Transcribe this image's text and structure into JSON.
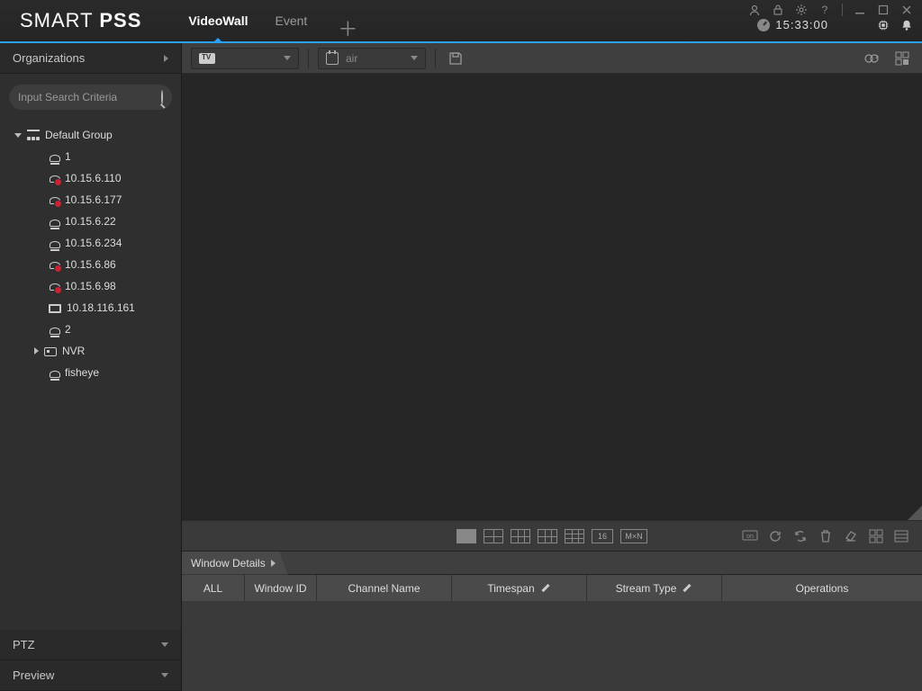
{
  "app": {
    "logo_light": "SMART",
    "logo_bold": "PSS"
  },
  "tabs": {
    "videowall": "VideoWall",
    "event": "Event"
  },
  "header": {
    "time": "15:33:00"
  },
  "sidebar": {
    "org_title": "Organizations",
    "search_placeholder": "Input Search Criteria",
    "ptz": "PTZ",
    "preview": "Preview",
    "tree": {
      "root": "Default Group",
      "items": [
        {
          "label": "1",
          "icon": "cam"
        },
        {
          "label": "10.15.6.110",
          "icon": "camerr"
        },
        {
          "label": "10.15.6.177",
          "icon": "camerr"
        },
        {
          "label": "10.15.6.22",
          "icon": "cam"
        },
        {
          "label": "10.15.6.234",
          "icon": "cam"
        },
        {
          "label": "10.15.6.86",
          "icon": "camerr"
        },
        {
          "label": "10.15.6.98",
          "icon": "camerr"
        },
        {
          "label": "10.18.116.161",
          "icon": "dev"
        },
        {
          "label": "2",
          "icon": "cam"
        },
        {
          "label": "NVR",
          "icon": "nvr",
          "expandable": true
        },
        {
          "label": "fisheye",
          "icon": "cam"
        }
      ]
    }
  },
  "toolbar": {
    "dd2_text": "air"
  },
  "layout": {
    "num16": "16",
    "mxn": "M×N"
  },
  "details": {
    "tab": "Window Details",
    "cols": {
      "all": "ALL",
      "winid": "Window ID",
      "chan": "Channel Name",
      "timespan": "Timespan",
      "stream": "Stream Type",
      "ops": "Operations"
    }
  }
}
